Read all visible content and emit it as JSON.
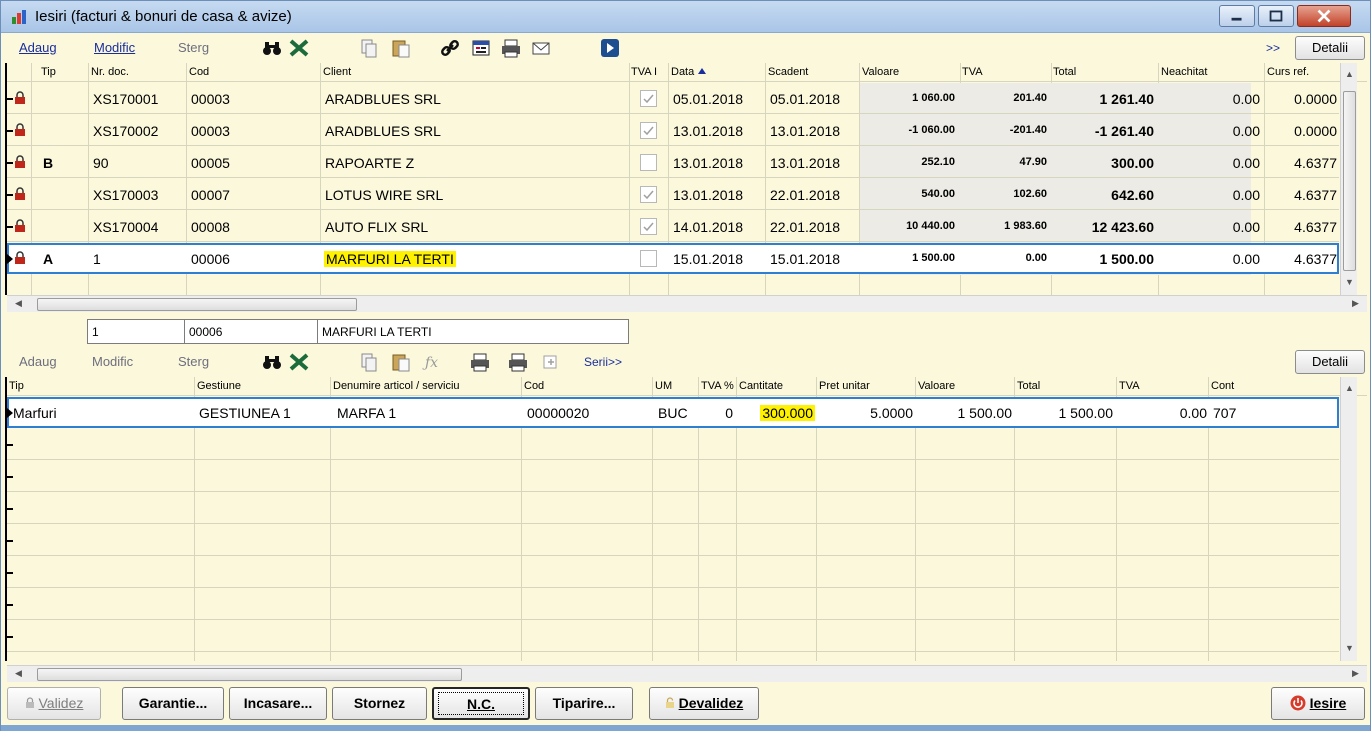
{
  "window": {
    "title": "Iesiri (facturi & bonuri de casa & avize)"
  },
  "top_toolbar": {
    "add_label": "Adaug",
    "modify_label": "Modific",
    "delete_label": "Sterg",
    "more_label": ">>",
    "details_label": "Detalii"
  },
  "top_grid": {
    "columns": [
      "Tip",
      "Nr. doc.",
      "Cod",
      "Client",
      "TVA I",
      "Data",
      "Scadent",
      "Valoare",
      "TVA",
      "Total",
      "Neachitat",
      "Curs ref."
    ],
    "rows": [
      {
        "tip": "",
        "nr_doc": "XS170001",
        "cod": "00003",
        "client": "ARADBLUES SRL",
        "tva_i": true,
        "data": "05.01.2018",
        "scadent": "05.01.2018",
        "valoare": "1 060.00",
        "tva": "201.40",
        "total": "1 261.40",
        "neachitat": "0.00",
        "curs_ref": "0.0000"
      },
      {
        "tip": "",
        "nr_doc": "XS170002",
        "cod": "00003",
        "client": "ARADBLUES SRL",
        "tva_i": true,
        "data": "13.01.2018",
        "scadent": "13.01.2018",
        "valoare": "-1 060.00",
        "tva": "-201.40",
        "total": "-1 261.40",
        "neachitat": "0.00",
        "curs_ref": "0.0000"
      },
      {
        "tip": "B",
        "nr_doc": "90",
        "cod": "00005",
        "client": "RAPOARTE Z",
        "tva_i": false,
        "data": "13.01.2018",
        "scadent": "13.01.2018",
        "valoare": "252.10",
        "tva": "47.90",
        "total": "300.00",
        "neachitat": "0.00",
        "curs_ref": "4.6377"
      },
      {
        "tip": "",
        "nr_doc": "XS170003",
        "cod": "00007",
        "client": "LOTUS WIRE SRL",
        "tva_i": true,
        "data": "13.01.2018",
        "scadent": "22.01.2018",
        "valoare": "540.00",
        "tva": "102.60",
        "total": "642.60",
        "neachitat": "0.00",
        "curs_ref": "4.6377"
      },
      {
        "tip": "",
        "nr_doc": "XS170004",
        "cod": "00008",
        "client": "AUTO FLIX SRL",
        "tva_i": true,
        "data": "14.01.2018",
        "scadent": "22.01.2018",
        "valoare": "10 440.00",
        "tva": "1 983.60",
        "total": "12 423.60",
        "neachitat": "0.00",
        "curs_ref": "4.6377"
      },
      {
        "tip": "A",
        "nr_doc": "1",
        "cod": "00006",
        "client": "MARFURI LA TERTI",
        "tva_i": false,
        "data": "15.01.2018",
        "scadent": "15.01.2018",
        "valoare": "1 500.00",
        "tva": "0.00",
        "total": "1 500.00",
        "neachitat": "0.00",
        "curs_ref": "4.6377"
      }
    ]
  },
  "detail_strip": {
    "nr_doc": "1",
    "cod": "00006",
    "client": "MARFURI LA TERTI"
  },
  "mid_toolbar": {
    "add_label": "Adaug",
    "modify_label": "Modific",
    "delete_label": "Sterg",
    "serii_label": "Serii>>",
    "details_label": "Detalii"
  },
  "bottom_grid": {
    "columns": [
      "Tip",
      "Gestiune",
      "Denumire articol / serviciu",
      "Cod",
      "UM",
      "TVA %",
      "Cantitate",
      "Pret unitar",
      "Valoare",
      "Total",
      "TVA",
      "Cont"
    ],
    "rows": [
      {
        "tip": "Marfuri",
        "gestiune": "GESTIUNEA 1",
        "denumire": "MARFA 1",
        "cod": "00000020",
        "um": "BUC",
        "tva_pct": "0",
        "cantitate": "300.000",
        "pret_unitar": "5.0000",
        "valoare": "1 500.00",
        "total": "1 500.00",
        "tva": "0.00",
        "cont": "707"
      }
    ]
  },
  "bottom_buttons": {
    "validez": "Validez",
    "garantie": "Garantie...",
    "incasare": "Incasare...",
    "stornez": "Stornez",
    "nc": "N.C.",
    "tiparire": "Tiparire...",
    "devalidez": "Devalidez",
    "iesire": "Iesire"
  },
  "colors": {
    "background": "#fbf8dc",
    "selection_border": "#2e7fd4",
    "highlight": "#fff200",
    "link": "#1a2e9c"
  }
}
